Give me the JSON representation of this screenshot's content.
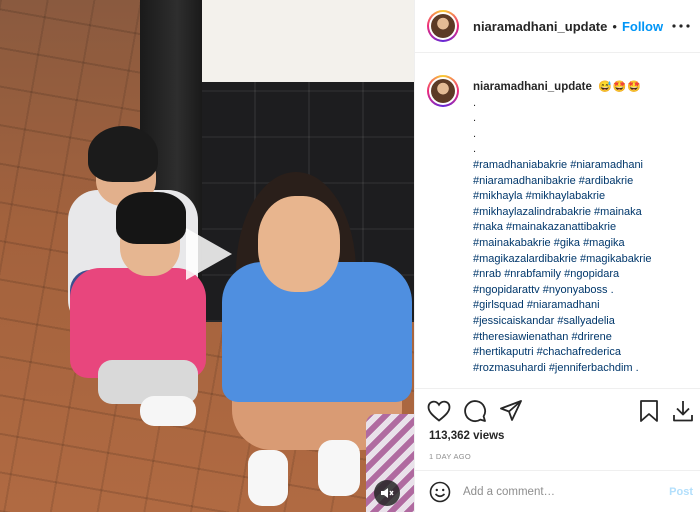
{
  "post": {
    "username": "niaramadhani_update",
    "follow_label": "Follow",
    "header_separator": "•",
    "caption_emojis": "😅🤩🤩",
    "caption_dots": [
      ".",
      ".",
      ".",
      "."
    ],
    "hashtags": [
      "#ramadhaniabakrie #niaramadhani",
      "#niaramadhanibakrie #ardibakrie",
      "#mikhayla #mikhaylabakrie",
      "#mikhaylazalindrabakrie #mainaka",
      "#naka #mainakazanattibakrie",
      "#mainakabakrie #gika #magika",
      "#magikazalardibakrie #magikabakrie",
      "#nrab #nrabfamily #ngopidara",
      "#ngopidarattv #nyonyaboss .",
      "#girlsquad #niaramadhani",
      "#jessicaiskandar #sallyadelia",
      "#theresiawienathan #drirene",
      "#hertikaputri #chachafrederica",
      "#rozmasuhardi #jenniferbachdim ."
    ],
    "views": "113,362 views",
    "date": "1 DAY AGO",
    "comment_placeholder": "Add a comment…",
    "post_label": "Post"
  },
  "icons": {
    "play": "play-icon",
    "mute": "speaker-mute-icon",
    "more": "more-options-icon",
    "like": "heart-icon",
    "comment": "comment-icon",
    "share": "paper-plane-icon",
    "save": "bookmark-icon",
    "download": "download-icon",
    "emoji": "smiley-icon"
  },
  "colors": {
    "link_blue": "#0095f6",
    "hashtag_blue": "#00376b",
    "post_disabled": "#b2dffc",
    "muted_text": "#8e8e8e"
  }
}
